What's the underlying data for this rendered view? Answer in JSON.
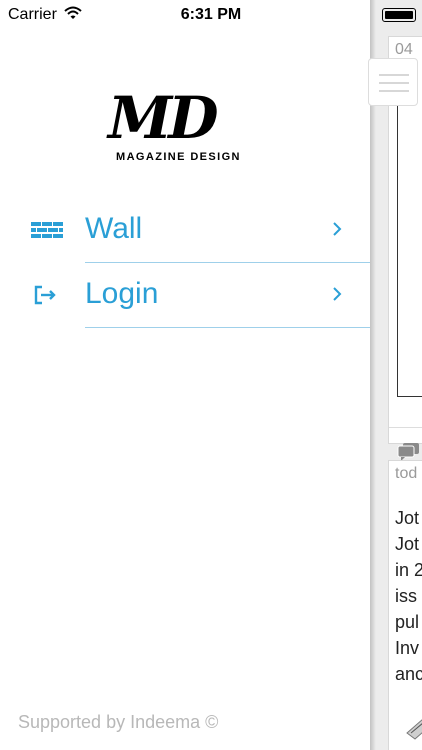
{
  "status_bar": {
    "carrier": "Carrier",
    "time": "6:31 PM"
  },
  "logo": {
    "mark": "MD",
    "subtitle": "MAGAZINE DESIGN"
  },
  "menu": {
    "items": [
      {
        "label": "Wall",
        "icon": "brick-wall-icon"
      },
      {
        "label": "Login",
        "icon": "login-icon"
      }
    ]
  },
  "footer": {
    "text": "Supported by Indeema ©"
  },
  "background_feed": {
    "card1_date": "04",
    "card2_date": "tod",
    "card2_text": "Jot\nJot\nin 2\niss\npul\nInv\nanc"
  },
  "colors": {
    "accent": "#2a9fd6",
    "divider": "#9fd0ea",
    "footer_text": "#b8b8b8"
  }
}
